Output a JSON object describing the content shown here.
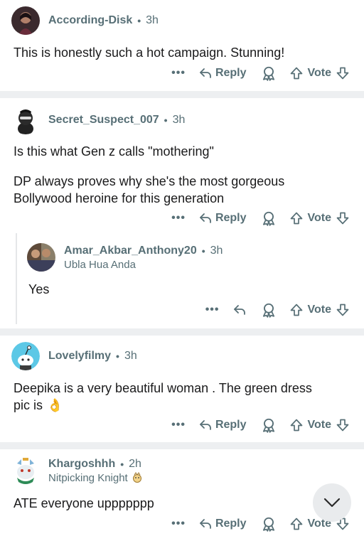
{
  "comments": [
    {
      "username": "According-Disk",
      "time": "3h",
      "body_lines": [
        "This is honestly such a hot campaign. Stunning!"
      ],
      "reply_label": "Reply",
      "vote_label": "Vote"
    },
    {
      "username": "Secret_Suspect_007",
      "time": "3h",
      "body_lines": [
        "Is this what Gen z calls \"mothering\"",
        "",
        "DP always proves why she's the most gorgeous",
        "Bollywood heroine for this generation"
      ],
      "reply_label": "Reply",
      "vote_label": "Vote"
    },
    {
      "username": "Amar_Akbar_Anthony20",
      "time": "3h",
      "flair": "Ubla Hua Anda",
      "body_lines": [
        "Yes"
      ],
      "vote_label": "Vote"
    },
    {
      "username": "Lovelyfilmy",
      "time": "3h",
      "body_lines": [
        "Deepika is a very beautiful woman . The green dress",
        "pic is"
      ],
      "emoji": "👌",
      "reply_label": "Reply",
      "vote_label": "Vote"
    },
    {
      "username": "Khargoshhh",
      "time": "2h",
      "flair": "Nitpicking Knight",
      "body_lines": [
        "ATE everyone uppppppp"
      ],
      "reply_label": "Reply",
      "vote_label": "Vote"
    }
  ],
  "more_label": "•••",
  "separator": "•",
  "icons": {
    "reply": "reply-arrow-icon",
    "award": "award-icon",
    "upvote": "upvote-arrow-icon",
    "downvote": "downvote-arrow-icon",
    "scroll": "chevron-down-icon"
  },
  "colors": {
    "meta": "#576f76",
    "divider": "#edeff1",
    "text": "#1a1a1b"
  }
}
